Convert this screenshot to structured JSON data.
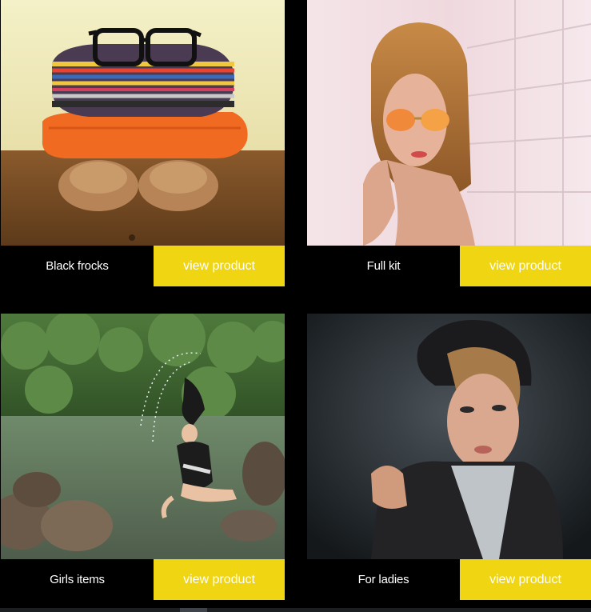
{
  "products": [
    {
      "name": "Black frocks",
      "button_label": "view product",
      "image": "folded-sweaters-glasses-shoes"
    },
    {
      "name": "Full kit",
      "button_label": "view product",
      "image": "woman-sunglasses"
    },
    {
      "name": "Girls items",
      "button_label": "view product",
      "image": "girl-splashing-lake"
    },
    {
      "name": "For ladies",
      "button_label": "view product",
      "image": "woman-fur-hat"
    }
  ],
  "colors": {
    "background": "#000000",
    "button": "#f0d512",
    "button_text": "#ffffff",
    "name_text": "#ffffff"
  }
}
